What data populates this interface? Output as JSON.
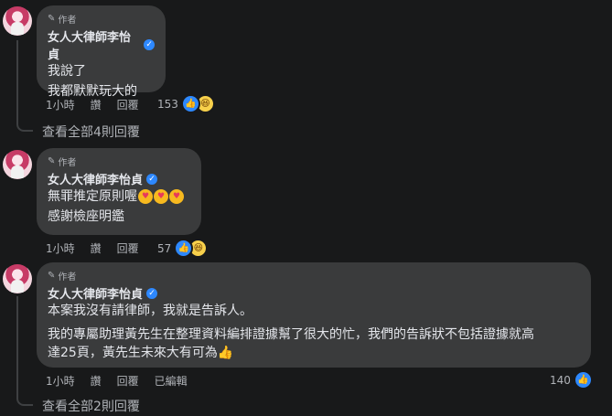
{
  "author_badge": "作者",
  "comments": [
    {
      "name": "女人大律師李怡貞",
      "lines": [
        "我說了",
        "我都默默玩大的"
      ],
      "actions": [
        "1小時",
        "讚",
        "回覆"
      ],
      "reaction_count": "153",
      "view_replies": "查看全部4則回覆"
    },
    {
      "name": "女人大律師李怡貞",
      "lines": [
        "無罪推定原則喔",
        "感謝檢座明鑑"
      ],
      "emojis": [
        "😍",
        "😍",
        "😍"
      ],
      "actions": [
        "1小時",
        "讚",
        "回覆"
      ],
      "reaction_count": "57"
    },
    {
      "name": "女人大律師李怡貞",
      "lines": [
        "本案我沒有請律師，我就是告訴人。",
        "我的專屬助理黃先生在整理資料編排證據幫了很大的忙，我們的告訴狀不包括證據就高",
        "達25頁，黃先生未來大有可為"
      ],
      "actions": [
        "1小時",
        "讚",
        "回覆",
        "已編輯"
      ],
      "reaction_count": "140",
      "view_replies": "查看全部2則回覆"
    }
  ],
  "icons": {
    "pencil": "pencil-icon",
    "verified": "verified-badge-icon",
    "like": "like-reaction-icon",
    "haha": "haha-reaction-icon",
    "love_face": "heart-eyes-emoji-icon",
    "thumbs_up": "thumbs-up-emoji-icon"
  },
  "colors": {
    "background": "#18191a",
    "bubble": "#3a3b3c",
    "verified_blue": "#2d88ff",
    "secondary_text": "#b0b3b8"
  }
}
